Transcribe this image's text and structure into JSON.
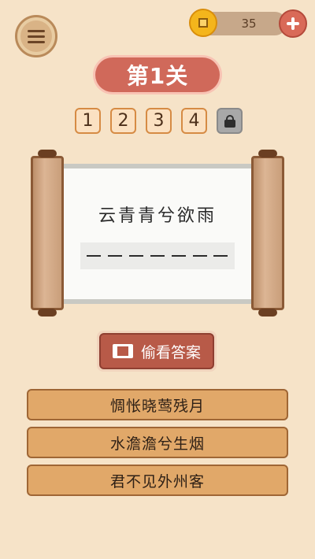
{
  "header": {
    "coins": "35"
  },
  "level": {
    "title": "第1关"
  },
  "stages": [
    {
      "label": "1",
      "locked": false
    },
    {
      "label": "2",
      "locked": false
    },
    {
      "label": "3",
      "locked": false
    },
    {
      "label": "4",
      "locked": false
    },
    {
      "label": "",
      "locked": true
    }
  ],
  "puzzle": {
    "given_line": "云青青兮欲雨",
    "blank_count": 7
  },
  "peek_button": {
    "label": "偷看答案"
  },
  "options": [
    {
      "text": "惆怅晓莺残月"
    },
    {
      "text": "水澹澹兮生烟"
    },
    {
      "text": "君不见外州客"
    }
  ],
  "colors": {
    "background": "#f6e3c8",
    "accent_red": "#d0695a",
    "option_fill": "#e1a869",
    "coin": "#f4b51c"
  },
  "icons": {
    "menu": "hamburger-icon",
    "coin": "coin-icon",
    "add": "plus-icon",
    "lock": "lock-icon",
    "video": "film-icon"
  }
}
